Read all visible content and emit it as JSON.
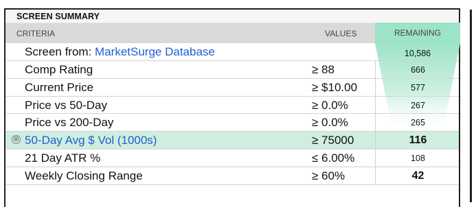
{
  "panel": {
    "title": "SCREEN SUMMARY",
    "columns": {
      "criteria": "CRITERIA",
      "values": "VALUES",
      "remaining": "REMAINING"
    }
  },
  "source_row": {
    "prefix": "Screen from: ",
    "link": "MarketSurge Database",
    "remaining": "10,586"
  },
  "criteria_rows": [
    {
      "label": "Comp Rating",
      "value": "≥ 88",
      "remaining": "666"
    },
    {
      "label": "Current Price",
      "value": "≥ $10.00",
      "remaining": "577"
    },
    {
      "label": "Price vs 50-Day",
      "value": "≥ 0.0%",
      "remaining": "267"
    },
    {
      "label": "Price vs 200-Day",
      "value": "≥ 0.0%",
      "remaining": "265"
    },
    {
      "label": "50-Day Avg $ Vol (1000s)",
      "value": "≥ 75000",
      "remaining": "116",
      "remove_glyph": "⊗"
    },
    {
      "label": "21 Day ATR %",
      "value": "≤ 6.00%",
      "remaining": "108"
    },
    {
      "label": "Weekly Closing Range",
      "value": "≥ 60%",
      "remaining": "42"
    }
  ],
  "colors": {
    "accent_green": "#9de3c7",
    "highlight_row": "#cfeedf",
    "link_blue": "#1f5fd1"
  },
  "icons": {
    "remove": "remove-criterion-icon"
  }
}
